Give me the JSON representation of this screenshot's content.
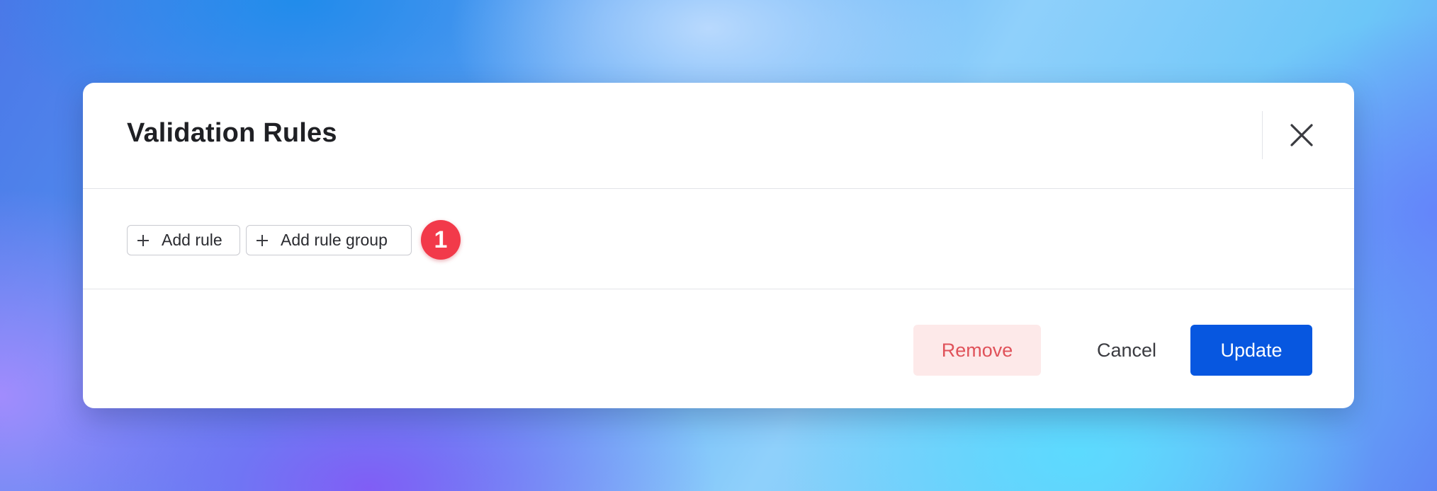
{
  "dialog": {
    "title": "Validation Rules",
    "close_icon": "close-icon"
  },
  "toolbar": {
    "add_rule_label": "Add rule",
    "add_rule_group_label": "Add rule group",
    "plus_icon": "plus-icon"
  },
  "annotation": {
    "badge_number": "1",
    "badge_color": "#f23a4a"
  },
  "footer": {
    "remove_label": "Remove",
    "cancel_label": "Cancel",
    "update_label": "Update"
  },
  "colors": {
    "accent": "#0757e0",
    "danger_text": "#e0525a",
    "danger_bg": "#fde9e9"
  }
}
